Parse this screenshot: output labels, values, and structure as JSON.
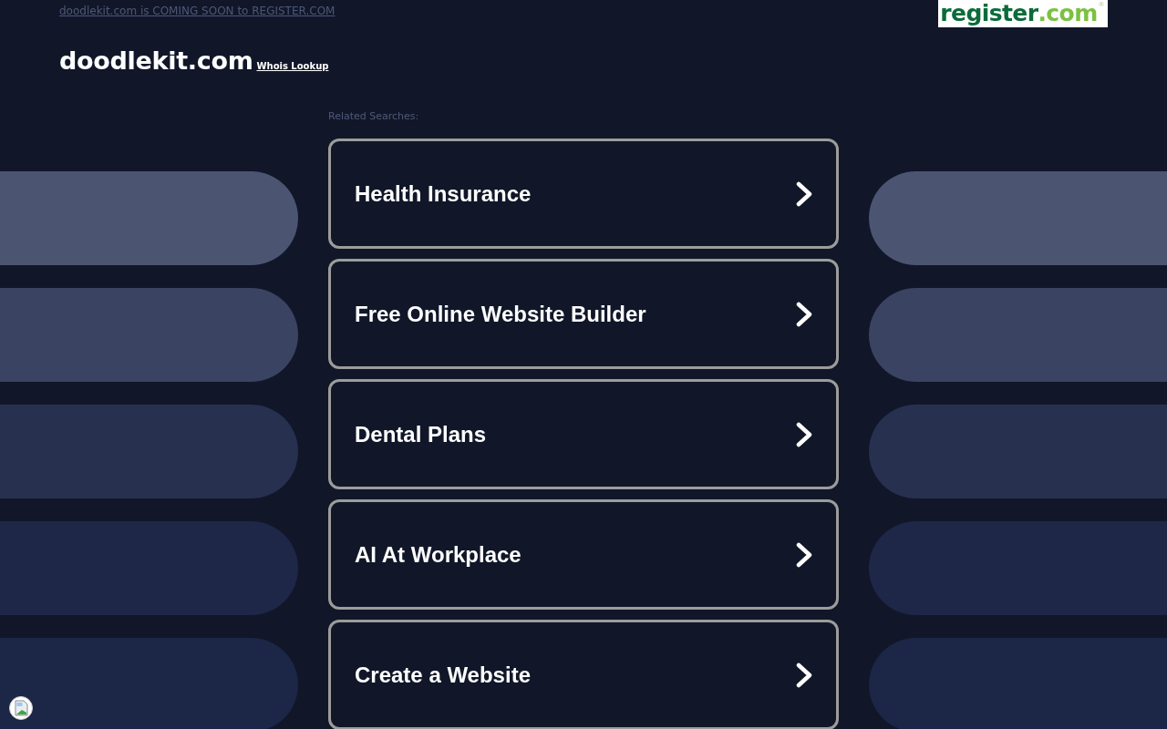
{
  "top_notice": {
    "text": "doodlekit.com is COMING SOON to REGISTER.COM"
  },
  "logo": {
    "name": "register",
    "tld": ".com",
    "mark": "®"
  },
  "domain": {
    "title": "doodlekit.com",
    "whois_link": "Whois Lookup"
  },
  "related_searches": {
    "label": "Related Searches:",
    "items": [
      {
        "label": "Health Insurance"
      },
      {
        "label": "Free Online Website Builder"
      },
      {
        "label": "Dental Plans"
      },
      {
        "label": "AI At Workplace"
      },
      {
        "label": "Create a Website"
      }
    ]
  }
}
